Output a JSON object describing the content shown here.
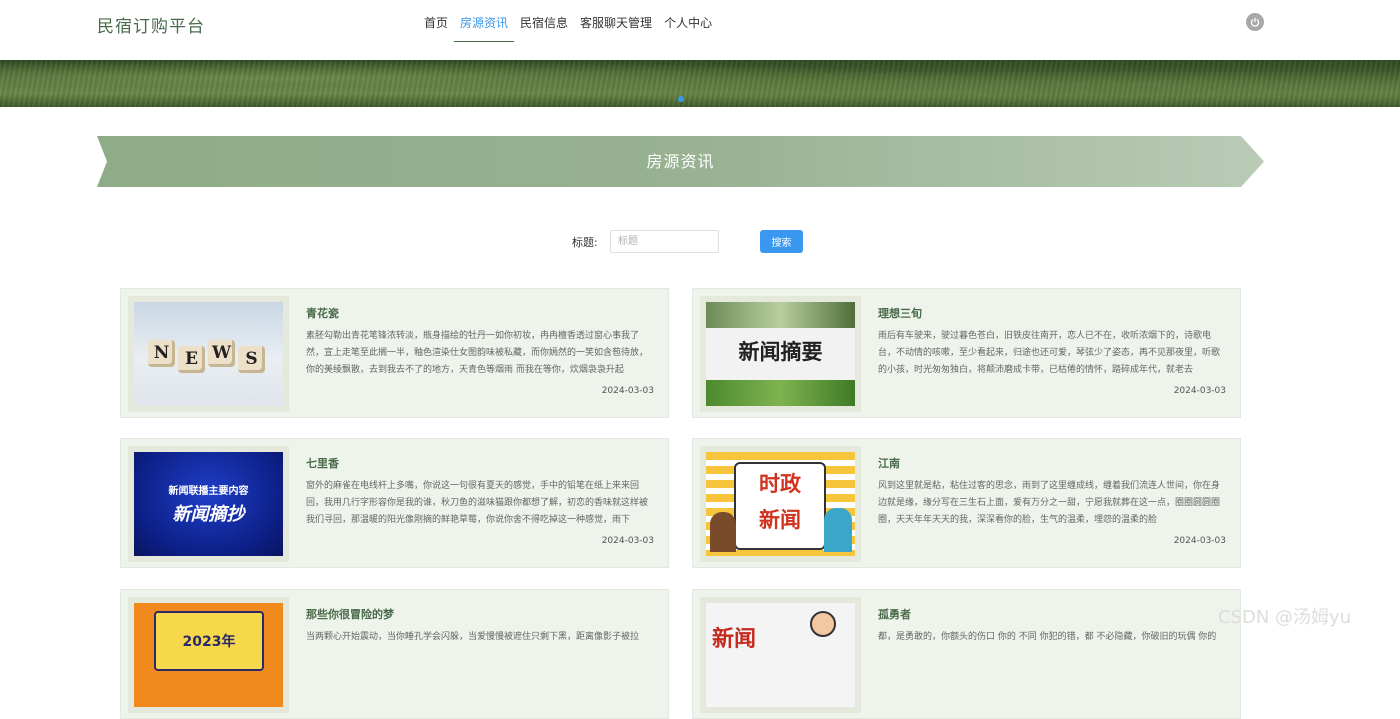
{
  "header": {
    "brand": "民宿订购平台",
    "nav": [
      "首页",
      "房源资讯",
      "民宿信息",
      "客服聊天管理",
      "个人中心"
    ],
    "active_nav": "房源资讯"
  },
  "section": {
    "title": "房源资讯"
  },
  "search": {
    "label": "标题:",
    "placeholder": "标题",
    "button": "搜索"
  },
  "articles": [
    {
      "title": "青花瓷",
      "desc": "素胚勾勒出青花笔锋浓转淡，瓶身描绘的牡丹一如你初妆，冉冉檀香透过窗心事我了然，宣上走笔至此搁一半，釉色渲染仕女图韵味被私藏，而你嫣然的一笑如含苞待放，你的美绫飘散，去到我去不了的地方，天青色等烟雨 而我在等你，炊烟袅袅升起",
      "date": "2024-03-03",
      "thumb_text": [
        "N",
        "E",
        "W",
        "S"
      ]
    },
    {
      "title": "理想三旬",
      "desc": "雨后有车驶来，驶过暮色苍白，旧铁皮往南开，恋人已不在，收听浓烟下的，诗歌电台，不动情的咳嗽，至少看起来，归途也还可爱，琴弦少了姿态，再不见那夜里，听歌的小孩，时光匆匆独白，将颠沛磨成卡带，已枯倦的情怀，踏碎成年代，就老去",
      "date": "2024-03-03",
      "thumb_text": "新闻摘要"
    },
    {
      "title": "七里香",
      "desc": "窗外的麻雀在电线杆上多嘴，你说这一句很有夏天的感觉，手中的铅笔在纸上来来回回，我用几行字形容你是我的谁，秋刀鱼的滋味猫跟你都想了解，初恋的香味就这样被我们寻回，那温暖的阳光像刚摘的鲜艳草莓，你说你舍不得吃掉这一种感觉，雨下",
      "date": "2024-03-03",
      "thumb_text": [
        "新闻联播主要内容",
        "新闻摘抄"
      ]
    },
    {
      "title": "江南",
      "desc": "风到这里就是粘，粘住过客的思念，雨到了这里缠成线，缠着我们流连人世间，你在身边就是缘，缘分写在三生石上面，爱有万分之一甜，宁愿我就葬在这一点，圈圈圆圆圈圈，天天年年天天的我，深深看你的脸，生气的温柔，埋怨的温柔的脸",
      "date": "2024-03-03",
      "thumb_text": [
        "时政",
        "新闻"
      ]
    },
    {
      "title": "那些你很冒险的梦",
      "desc": "当两颗心开始震动，当你睡孔学会闪躲，当爱慢慢被遮住只剩下黑，距离像影子被拉",
      "date": "",
      "thumb_text": "2023年"
    },
    {
      "title": "孤勇者",
      "desc": "都，是勇敢的，你额头的伤口 你的 不同 你犯的错，都 不必隐藏，你破旧的玩偶 你的",
      "date": "",
      "thumb_text": "新闻"
    }
  ],
  "watermark": "CSDN @汤姆yu",
  "colors": {
    "brand": "#4a6b4a",
    "accent": "#3a98e8",
    "card_bg": "#eef3ec",
    "title_bar": "#8fac88"
  }
}
